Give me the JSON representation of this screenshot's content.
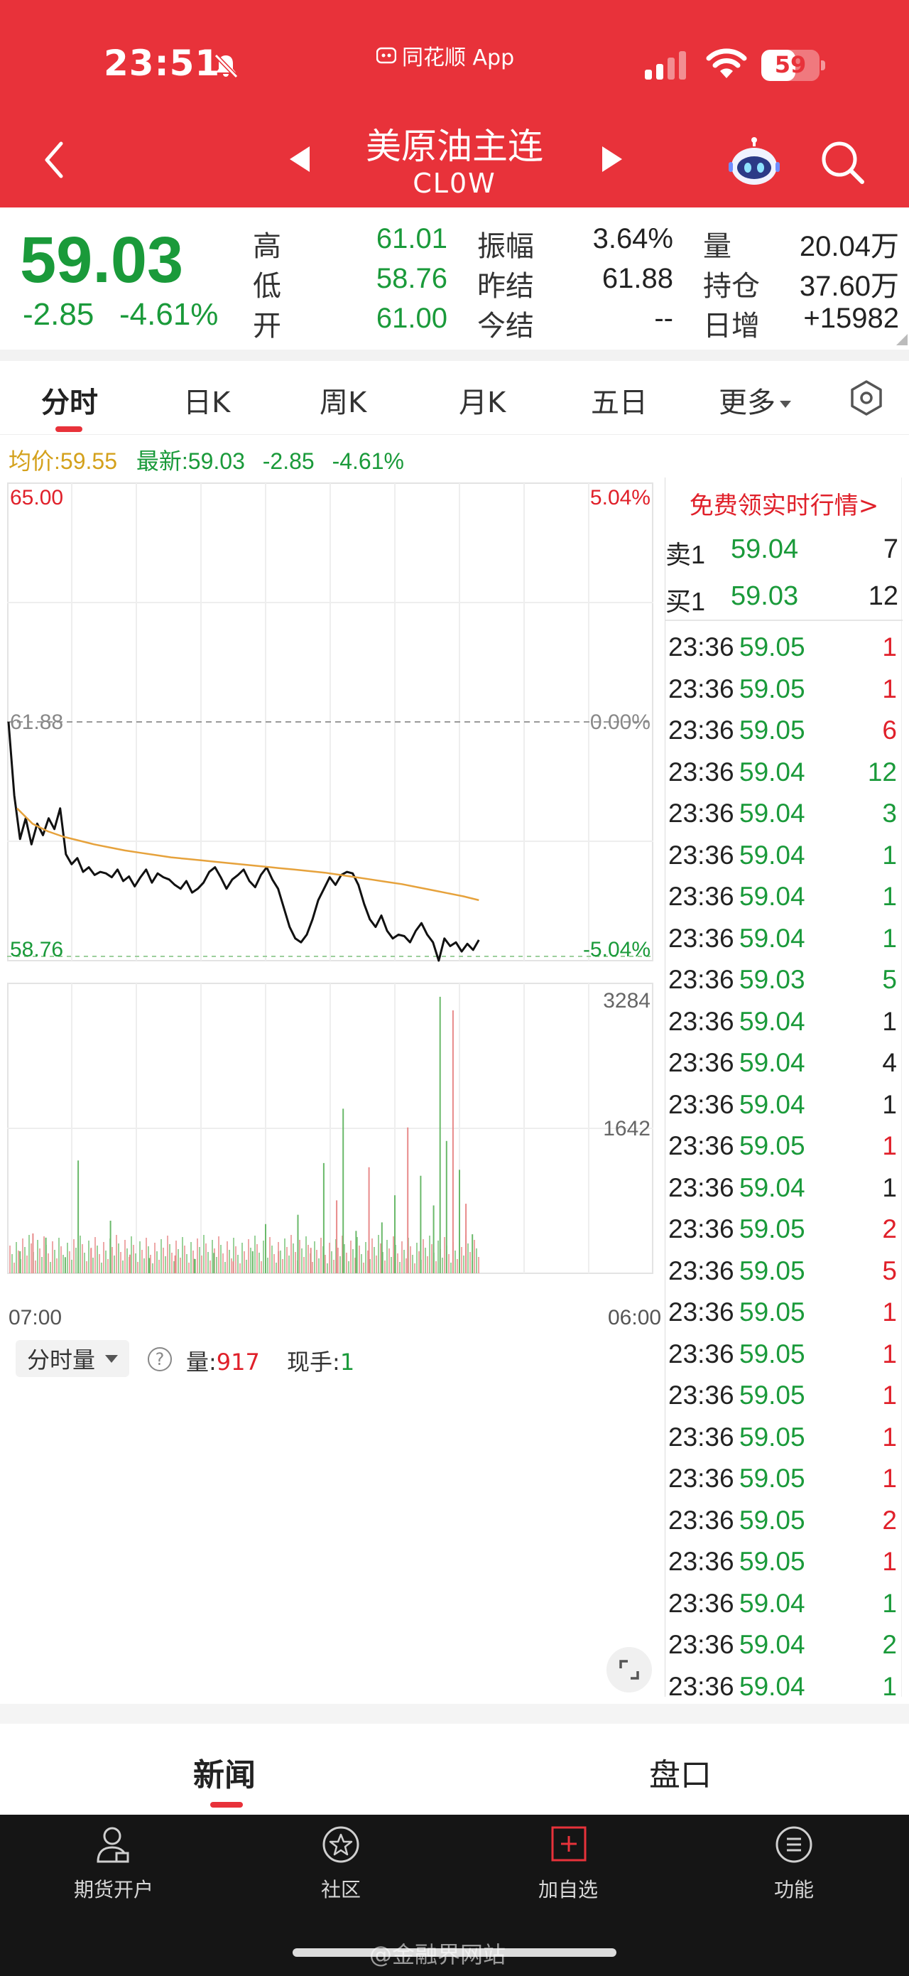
{
  "status_bar": {
    "time": "23:51",
    "app_name": "同花顺 App",
    "battery": "59"
  },
  "header": {
    "title": "美原油主连",
    "code": "CL0W"
  },
  "quote": {
    "price": "59.03",
    "change": "-2.85",
    "change_pct": "-4.61%",
    "grid": [
      {
        "label": "高",
        "value": "61.01",
        "color": "green"
      },
      {
        "label": "振幅",
        "value": "3.64%",
        "color": "dark"
      },
      {
        "label": "量",
        "value": "20.04万",
        "color": "dark"
      },
      {
        "label": "低",
        "value": "58.76",
        "color": "green"
      },
      {
        "label": "昨结",
        "value": "61.88",
        "color": "dark"
      },
      {
        "label": "持仓",
        "value": "37.60万",
        "color": "dark"
      },
      {
        "label": "开",
        "value": "61.00",
        "color": "green"
      },
      {
        "label": "今结",
        "value": "--",
        "color": "dark"
      },
      {
        "label": "日增",
        "value": "+15982",
        "color": "dark"
      }
    ]
  },
  "chart_tabs": [
    "分时",
    "日K",
    "周K",
    "月K",
    "五日",
    "更多"
  ],
  "avg_line": {
    "avg_label": "均价:",
    "avg_value": "59.55",
    "new_label": "最新:",
    "new_value": "59.03",
    "change": "-2.85",
    "change_pct": "-4.61%"
  },
  "chart_data": [
    {
      "type": "line",
      "title": "",
      "y_left_labels": {
        "top": "65.00",
        "mid": "61.88",
        "bottom": "58.76"
      },
      "y_right_labels": {
        "top": "5.04%",
        "mid": "0.00%",
        "bottom": "-5.04%"
      },
      "x_labels": {
        "start": "07:00",
        "end": "06:00"
      },
      "ylim": [
        58.76,
        65.0
      ],
      "reference": 61.88,
      "x_range_fraction": [
        0,
        0.73
      ],
      "series": [
        {
          "name": "最新",
          "color": "#111111",
          "values": [
            61.88,
            60.92,
            60.35,
            60.62,
            60.28,
            60.55,
            60.4,
            60.62,
            60.48,
            60.75,
            60.15,
            60.02,
            60.1,
            59.92,
            59.98,
            59.88,
            59.92,
            59.9,
            59.85,
            59.95,
            59.8,
            59.86,
            59.73,
            59.85,
            59.95,
            59.78,
            59.9,
            59.85,
            59.82,
            59.75,
            59.7,
            59.8,
            59.65,
            59.7,
            59.78,
            59.92,
            59.98,
            59.85,
            59.7,
            59.82,
            59.88,
            59.95,
            59.8,
            59.72,
            59.88,
            59.98,
            59.82,
            59.7,
            59.45,
            59.2,
            59.05,
            59.0,
            59.1,
            59.3,
            59.55,
            59.7,
            59.85,
            59.75,
            59.88,
            59.92,
            59.9,
            59.75,
            59.5,
            59.3,
            59.2,
            59.35,
            59.15,
            59.05,
            59.1,
            59.08,
            59.0,
            59.15,
            59.25,
            59.1,
            59.0,
            58.76,
            59.05,
            58.95,
            59.0,
            58.88,
            58.98,
            58.9,
            59.03
          ]
        },
        {
          "name": "均价",
          "color": "#e6a23c",
          "values": [
            60.75,
            60.55,
            60.45,
            60.38,
            60.33,
            60.28,
            60.24,
            60.2,
            60.17,
            60.14,
            60.11,
            60.09,
            60.07,
            60.05,
            60.03,
            60.01,
            59.99,
            59.97,
            59.95,
            59.93,
            59.91,
            59.88,
            59.85,
            59.82,
            59.79,
            59.76,
            59.72,
            59.68,
            59.64,
            59.6,
            59.55
          ]
        }
      ]
    },
    {
      "type": "bar",
      "title": "分时量",
      "y_labels": {
        "top": "3284",
        "mid": "1642"
      },
      "ylim": [
        0,
        3284
      ],
      "bars": [
        {
          "x": 0.02,
          "v": 260,
          "c": "g"
        },
        {
          "x": 0.04,
          "v": 470,
          "c": "r"
        },
        {
          "x": 0.06,
          "v": 420,
          "c": "g"
        },
        {
          "x": 0.09,
          "v": 190,
          "c": "g"
        },
        {
          "x": 0.11,
          "v": 1330,
          "c": "g"
        },
        {
          "x": 0.13,
          "v": 300,
          "c": "r"
        },
        {
          "x": 0.16,
          "v": 620,
          "c": "g"
        },
        {
          "x": 0.19,
          "v": 220,
          "c": "r"
        },
        {
          "x": 0.22,
          "v": 180,
          "c": "g"
        },
        {
          "x": 0.26,
          "v": 210,
          "c": "r"
        },
        {
          "x": 0.29,
          "v": 170,
          "c": "g"
        },
        {
          "x": 0.32,
          "v": 240,
          "c": "g"
        },
        {
          "x": 0.35,
          "v": 140,
          "c": "r"
        },
        {
          "x": 0.38,
          "v": 260,
          "c": "g"
        },
        {
          "x": 0.4,
          "v": 580,
          "c": "g"
        },
        {
          "x": 0.42,
          "v": 260,
          "c": "r"
        },
        {
          "x": 0.45,
          "v": 690,
          "c": "g"
        },
        {
          "x": 0.47,
          "v": 300,
          "c": "r"
        },
        {
          "x": 0.49,
          "v": 1300,
          "c": "g"
        },
        {
          "x": 0.51,
          "v": 860,
          "c": "r"
        },
        {
          "x": 0.52,
          "v": 1940,
          "c": "g"
        },
        {
          "x": 0.54,
          "v": 500,
          "c": "g"
        },
        {
          "x": 0.56,
          "v": 1250,
          "c": "r"
        },
        {
          "x": 0.58,
          "v": 600,
          "c": "g"
        },
        {
          "x": 0.6,
          "v": 920,
          "c": "g"
        },
        {
          "x": 0.62,
          "v": 1720,
          "c": "r"
        },
        {
          "x": 0.64,
          "v": 1150,
          "c": "g"
        },
        {
          "x": 0.66,
          "v": 800,
          "c": "g"
        },
        {
          "x": 0.67,
          "v": 3260,
          "c": "g"
        },
        {
          "x": 0.68,
          "v": 1560,
          "c": "g"
        },
        {
          "x": 0.69,
          "v": 3100,
          "c": "r"
        },
        {
          "x": 0.7,
          "v": 1220,
          "c": "g"
        },
        {
          "x": 0.71,
          "v": 820,
          "c": "r"
        },
        {
          "x": 0.72,
          "v": 460,
          "c": "g"
        }
      ]
    }
  ],
  "order_book": {
    "free_link": "免费领实时行情>",
    "sell": {
      "label": "卖1",
      "price": "59.04",
      "qty": "7"
    },
    "buy": {
      "label": "买1",
      "price": "59.03",
      "qty": "12"
    }
  },
  "ticks": [
    {
      "t": "23:36",
      "p": "59.05",
      "v": "1",
      "pc": "green",
      "vc": "red"
    },
    {
      "t": "23:36",
      "p": "59.05",
      "v": "1",
      "pc": "green",
      "vc": "red"
    },
    {
      "t": "23:36",
      "p": "59.05",
      "v": "6",
      "pc": "green",
      "vc": "red"
    },
    {
      "t": "23:36",
      "p": "59.04",
      "v": "12",
      "pc": "green",
      "vc": "green"
    },
    {
      "t": "23:36",
      "p": "59.04",
      "v": "3",
      "pc": "green",
      "vc": "green"
    },
    {
      "t": "23:36",
      "p": "59.04",
      "v": "1",
      "pc": "green",
      "vc": "green"
    },
    {
      "t": "23:36",
      "p": "59.04",
      "v": "1",
      "pc": "green",
      "vc": "green"
    },
    {
      "t": "23:36",
      "p": "59.04",
      "v": "1",
      "pc": "green",
      "vc": "green"
    },
    {
      "t": "23:36",
      "p": "59.03",
      "v": "5",
      "pc": "green",
      "vc": "green"
    },
    {
      "t": "23:36",
      "p": "59.04",
      "v": "1",
      "pc": "green",
      "vc": "dark"
    },
    {
      "t": "23:36",
      "p": "59.04",
      "v": "4",
      "pc": "green",
      "vc": "dark"
    },
    {
      "t": "23:36",
      "p": "59.04",
      "v": "1",
      "pc": "green",
      "vc": "dark"
    },
    {
      "t": "23:36",
      "p": "59.05",
      "v": "1",
      "pc": "green",
      "vc": "red"
    },
    {
      "t": "23:36",
      "p": "59.04",
      "v": "1",
      "pc": "green",
      "vc": "dark"
    },
    {
      "t": "23:36",
      "p": "59.05",
      "v": "2",
      "pc": "green",
      "vc": "red"
    },
    {
      "t": "23:36",
      "p": "59.05",
      "v": "5",
      "pc": "green",
      "vc": "red"
    },
    {
      "t": "23:36",
      "p": "59.05",
      "v": "1",
      "pc": "green",
      "vc": "red"
    },
    {
      "t": "23:36",
      "p": "59.05",
      "v": "1",
      "pc": "green",
      "vc": "red"
    },
    {
      "t": "23:36",
      "p": "59.05",
      "v": "1",
      "pc": "green",
      "vc": "red"
    },
    {
      "t": "23:36",
      "p": "59.05",
      "v": "1",
      "pc": "green",
      "vc": "red"
    },
    {
      "t": "23:36",
      "p": "59.05",
      "v": "1",
      "pc": "green",
      "vc": "red"
    },
    {
      "t": "23:36",
      "p": "59.05",
      "v": "2",
      "pc": "green",
      "vc": "red"
    },
    {
      "t": "23:36",
      "p": "59.05",
      "v": "1",
      "pc": "green",
      "vc": "red"
    },
    {
      "t": "23:36",
      "p": "59.04",
      "v": "1",
      "pc": "green",
      "vc": "green"
    },
    {
      "t": "23:36",
      "p": "59.04",
      "v": "2",
      "pc": "green",
      "vc": "green"
    },
    {
      "t": "23:36",
      "p": "59.04",
      "v": "1",
      "pc": "green",
      "vc": "green"
    }
  ],
  "volume_panel": {
    "selector": "分时量",
    "help": "?",
    "vol_label": "量:",
    "vol_value": "917",
    "hand_label": "现手:",
    "hand_value": "1"
  },
  "bottom_tabs": [
    "新闻",
    "盘口"
  ],
  "nav": [
    {
      "label": "期货开户",
      "icon": "user-account-icon"
    },
    {
      "label": "社区",
      "icon": "community-star-icon"
    },
    {
      "label": "加自选",
      "icon": "add-watchlist-icon"
    },
    {
      "label": "功能",
      "icon": "menu-list-icon"
    }
  ],
  "watermark": "@金融界网站",
  "colors": {
    "brand_red": "#e8323a",
    "down_green": "#1a9a3a",
    "up_red": "#e0202a",
    "avg_orange": "#e6a23c"
  }
}
